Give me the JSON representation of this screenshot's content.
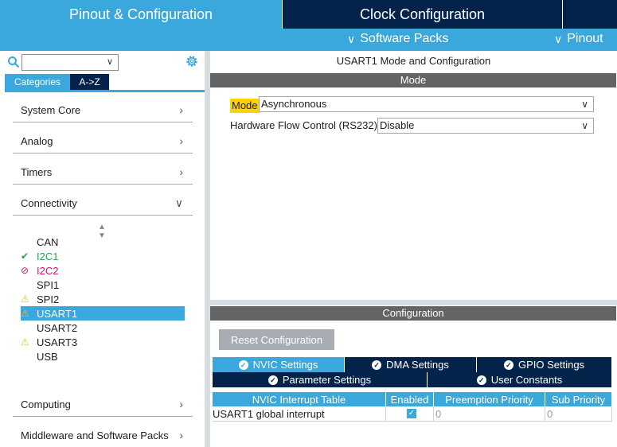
{
  "top_tabs": {
    "pinout": "Pinout & Configuration",
    "clock": "Clock Configuration",
    "extra": ""
  },
  "subbar": {
    "software_packs": "Software Packs",
    "pinout": "Pinout"
  },
  "left": {
    "search": {
      "value": ""
    },
    "tabs": {
      "categories": "Categories",
      "az": "A->Z"
    },
    "categories": [
      {
        "label": "System Core",
        "expanded": false
      },
      {
        "label": "Analog",
        "expanded": false
      },
      {
        "label": "Timers",
        "expanded": false
      },
      {
        "label": "Connectivity",
        "expanded": true
      },
      {
        "label": "Computing",
        "expanded": false
      },
      {
        "label": "Middleware and Software Packs",
        "expanded": false
      }
    ],
    "peripherals": [
      {
        "label": "CAN",
        "status": "none"
      },
      {
        "label": "I2C1",
        "status": "ok"
      },
      {
        "label": "I2C2",
        "status": "blocked"
      },
      {
        "label": "SPI1",
        "status": "none"
      },
      {
        "label": "SPI2",
        "status": "warning"
      },
      {
        "label": "USART1",
        "status": "warning",
        "selected": true
      },
      {
        "label": "USART2",
        "status": "none"
      },
      {
        "label": "USART3",
        "status": "warning"
      },
      {
        "label": "USB",
        "status": "none"
      }
    ]
  },
  "right": {
    "title": "USART1 Mode and Configuration",
    "mode_header": "Mode",
    "mode_label": "Mode",
    "mode_value": "Asynchronous",
    "flow_label": "Hardware Flow Control (RS232)",
    "flow_value": "Disable",
    "config_header": "Configuration",
    "reset_button": "Reset Configuration",
    "settings_tabs": {
      "nvic": "NVIC Settings",
      "dma": "DMA Settings",
      "gpio": "GPIO Settings",
      "parameter": "Parameter Settings",
      "user_constants": "User Constants"
    },
    "table": {
      "headers": [
        "NVIC Interrupt Table",
        "Enabled",
        "Preemption Priority",
        "Sub Priority"
      ],
      "rows": [
        {
          "name": "USART1 global interrupt",
          "enabled": true,
          "preemption": "0",
          "sub": "0"
        }
      ]
    }
  },
  "colors": {
    "accent_blue": "#3aa8dc",
    "navy": "#03234b",
    "highlight_yellow": "#ffd200",
    "ok_green": "#2aa24a",
    "blocked_magenta": "#d0136d",
    "warning_yellow": "#f5c400"
  }
}
